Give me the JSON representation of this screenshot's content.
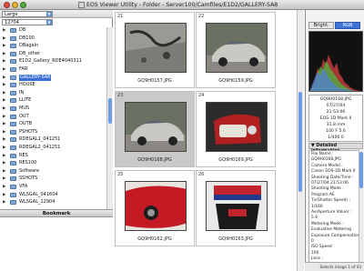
{
  "window": {
    "title": "EOS Viewer Utility - Folder - Server100/Camfiles/E1D2/GALLERY-SA8"
  },
  "left_panel": {
    "size_select": "Large",
    "drive_select": "12?04",
    "tree": [
      "DB",
      "DB100",
      "DBagain",
      "DB_other",
      "E1D2_Gallery_RDE4040311",
      "FAR",
      "GALLERY-SA8",
      "HOUSE",
      "IN",
      "LLITE",
      "MUS",
      "OUT",
      "OUTB",
      "PSHOTS",
      "RDEGAL1_041251",
      "RDEGAL2_041251",
      "RES",
      "RES100",
      "Software",
      "SSHOTS",
      "VFA",
      "WLSGAL_041604",
      "WLSGAL_12904"
    ],
    "selected_index": 6,
    "bookmark_label": "Bookmark"
  },
  "grid": {
    "cells": [
      {
        "num": "21",
        "filename": "GQ9H0157.JPG",
        "kind": "pavement"
      },
      {
        "num": "22",
        "filename": "GQ9H0159.JPG",
        "kind": "car"
      },
      {
        "num": "23",
        "filename": "GQ9H0168.JPG",
        "kind": "car",
        "selected": true
      },
      {
        "num": "24",
        "filename": "GQ9H0169.JPG",
        "kind": "interior"
      },
      {
        "num": "25",
        "filename": "GQ9H0162.JPG",
        "kind": "redcar"
      },
      {
        "num": "26",
        "filename": "GQ9H0163.JPG",
        "kind": "banner"
      }
    ]
  },
  "right_panel": {
    "tabs": [
      "Bright.",
      "RGB"
    ],
    "active_tab": 1,
    "info_lines": [
      "GQ9H0168.JPG",
      "07/27/04",
      "21:53:06",
      "EOS-1D Mark II",
      "31.8 mm",
      "100    F 5.6",
      "1/400    0"
    ],
    "detail_header": "Detailed information",
    "detail_lines": [
      "File Name :",
      "   GQ9H0168.JPG",
      "Camera Model :",
      "   Canon EOS-1D Mark II",
      "Shooting Date/Time :",
      "   07/27/04 21:53:06",
      "Shooting Mode :",
      "   Program AE",
      "Tv(Shutter Speed) :",
      "   1/160",
      "Av(Aperture Value) :",
      "   5.6",
      "Metering Mode :",
      "   Evaluative Metering",
      "Exposure Compensation :",
      "   0",
      "ISO Speed :",
      "   100",
      "Lens :"
    ],
    "status": "Selects image 1 of 43"
  },
  "colors": {
    "selection_blue": "#3b6fd8",
    "histogram_bg": "#111111"
  }
}
